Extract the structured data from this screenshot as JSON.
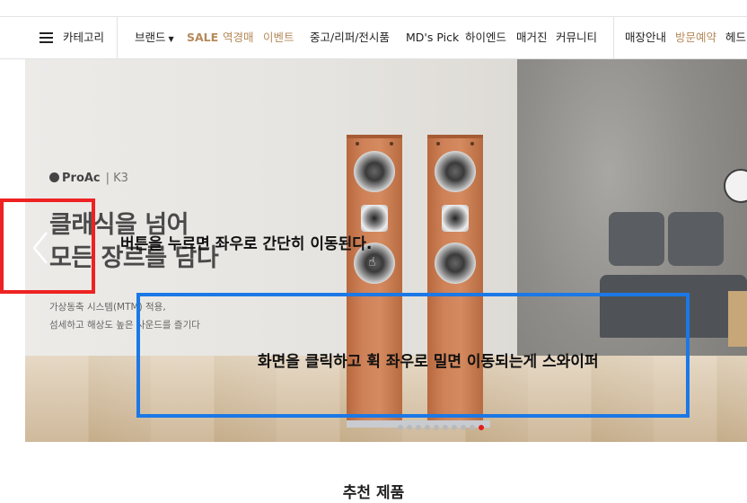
{
  "nav": {
    "category": "카테고리",
    "brand": "브랜드",
    "sale": "SALE",
    "reverse_auction": "역경매",
    "event": "이벤트",
    "used": "중고/리퍼/전시품",
    "mds_pick": "MD's Pick",
    "hi_end": "하이엔드",
    "magazine": "매거진",
    "community": "커뮤니티",
    "store_info": "매장안내",
    "visit_reservation": "방문예약",
    "headphones": "헤드"
  },
  "banner": {
    "brand_logo": "ProAc",
    "model": "K3",
    "headline_line1": "클래식을 넘어",
    "headline_line2": "모든 장르를 담다",
    "sub_line1": "가상동축 시스템(MTM) 적용,",
    "sub_line2": "섬세하고 해상도 높은 사운드를 즐기다",
    "slide_count": 10,
    "active_slide": 10
  },
  "annotations": {
    "button_note": "버튼을 누르면 좌우로 간단히 이동된다.",
    "swipe_note": "화면을 클릭하고 휙 좌우로 밀면 이동되는게 스와이퍼"
  },
  "colors": {
    "accent_nav": "#b5895a",
    "annotation_red": "#ee2222",
    "annotation_blue": "#1b78e6",
    "active_dot": "#e31d1d"
  },
  "icons": {
    "menu": "hamburger-icon",
    "prev": "chevron-left-icon"
  },
  "section": {
    "recommended_title": "추천 제품"
  }
}
